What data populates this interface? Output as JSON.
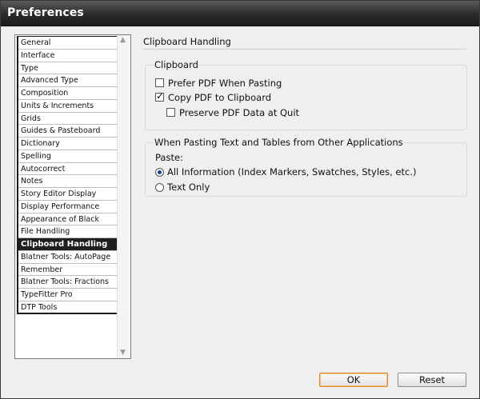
{
  "window": {
    "title": "Preferences"
  },
  "sidebar": {
    "items": [
      "General",
      "Interface",
      "Type",
      "Advanced Type",
      "Composition",
      "Units & Increments",
      "Grids",
      "Guides & Pasteboard",
      "Dictionary",
      "Spelling",
      "Autocorrect",
      "Notes",
      "Story Editor Display",
      "Display Performance",
      "Appearance of Black",
      "File Handling",
      "Clipboard Handling",
      "Blatner Tools: AutoPage",
      "Remember",
      "Blatner Tools: Fractions",
      "TypeFitter Pro",
      "DTP Tools"
    ],
    "selected": "Clipboard Handling"
  },
  "panel": {
    "title": "Clipboard Handling",
    "clipboard_group": {
      "label": "Clipboard",
      "prefer_pdf": {
        "pre": "",
        "hot": "",
        "post": "Prefer PDF When Pasting",
        "checked": false
      },
      "copy_pdf": {
        "label": "Copy PDF to Clipboard",
        "checked": true
      },
      "preserve_pdf": {
        "label": "Preserve PDF Data at Quit",
        "checked": false
      }
    },
    "paste_group": {
      "label": "When Pasting Text and Tables from Other Applications",
      "paste_label": "Paste:",
      "all_info": {
        "label": "All Information (Index Markers, Swatches, Styles, etc.)",
        "selected": true
      },
      "text_only": {
        "label": "Text Only",
        "selected": false
      }
    }
  },
  "buttons": {
    "ok": "OK",
    "reset": "Reset"
  }
}
